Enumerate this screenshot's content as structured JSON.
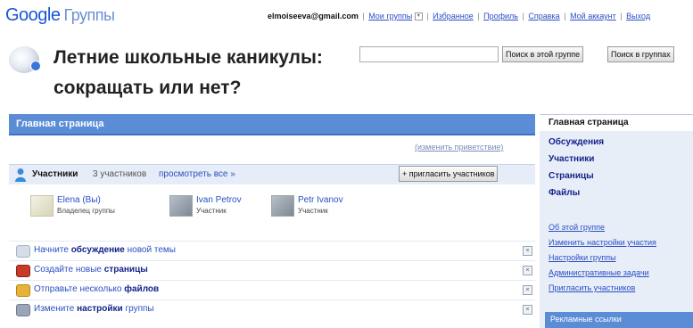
{
  "header": {
    "logo_google": "Google",
    "logo_groups": "Группы",
    "email": "elmoiseeva@gmail.com",
    "links": [
      "Мои группы",
      "Избранное",
      "Профиль",
      "Справка",
      "Мой аккаунт",
      "Выход"
    ]
  },
  "group": {
    "title_line1": "Летние школьные каникулы:",
    "title_line2": "сокращать или нет?"
  },
  "search": {
    "value": "",
    "btn_this_group": "Поиск в этой группе",
    "btn_groups": "Поиск в группах"
  },
  "main": {
    "tab_label": "Главная страница",
    "edit_welcome": "(изменить приветствие)",
    "members_label": "Участники",
    "members_count": "3 участников",
    "view_all": "просмотреть все »",
    "invite_button": "+ пригласить участников",
    "members": [
      {
        "name": "Elena (Вы)",
        "role": "Владелец группы"
      },
      {
        "name": "Ivan Petrov",
        "role": "Участник"
      },
      {
        "name": "Petr Ivanov",
        "role": "Участник"
      }
    ],
    "tasks": [
      {
        "pre": "Начните ",
        "bold": "обсуждение",
        "post": " новой темы"
      },
      {
        "pre": "Создайте новые ",
        "bold": "страницы",
        "post": ""
      },
      {
        "pre": "Отправьте несколько ",
        "bold": "файлов",
        "post": ""
      },
      {
        "pre": "Измените ",
        "bold": "настройки",
        "post": " группы"
      }
    ]
  },
  "sidebar": {
    "current": "Главная страница",
    "nav": [
      "Обсуждения",
      "Участники",
      "Страницы",
      "Файлы"
    ],
    "links": [
      "Об этой группе",
      "Изменить настройки участия",
      "Настройки группы",
      "Административные задачи",
      "Пригласить участников"
    ],
    "ads": "Рекламные ссылки"
  },
  "colors": {
    "accent": "#5b8cd6",
    "link": "#2a4fc4"
  }
}
